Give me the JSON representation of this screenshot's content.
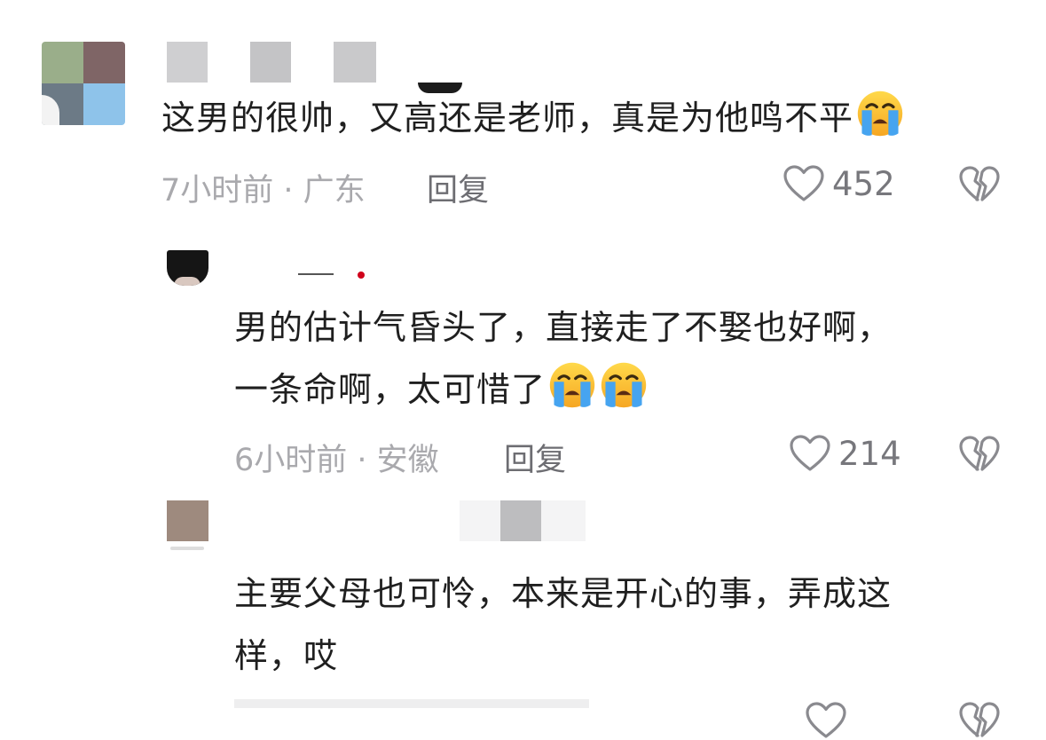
{
  "comments": [
    {
      "text_lines": [
        "这男的很帅，又高还是老师，真是为他鸣不平"
      ],
      "emoji_count": 1,
      "meta": "7小时前 · 广东",
      "reply_label": "回复",
      "likes": "452"
    },
    {
      "text_lines": [
        "男的估计气昏头了，直接走了不娶也好啊，",
        "一条命啊，太可惜了"
      ],
      "emoji_count": 2,
      "meta": "6小时前 · 安徽",
      "reply_label": "回复",
      "likes": "214"
    },
    {
      "text_lines": [
        "主要父母也可怜，本来是开心的事，弄成这",
        "样，哎"
      ],
      "emoji_count": 0
    }
  ],
  "icons": {
    "emoji": "loudly-crying-face-icon",
    "like": "heart-outline-icon",
    "dislike": "broken-heart-icon"
  },
  "colors": {
    "text": "#1f1f1f",
    "meta": "#a9a9ad",
    "reply": "#6d6d72",
    "icon": "#8a8a8f"
  }
}
